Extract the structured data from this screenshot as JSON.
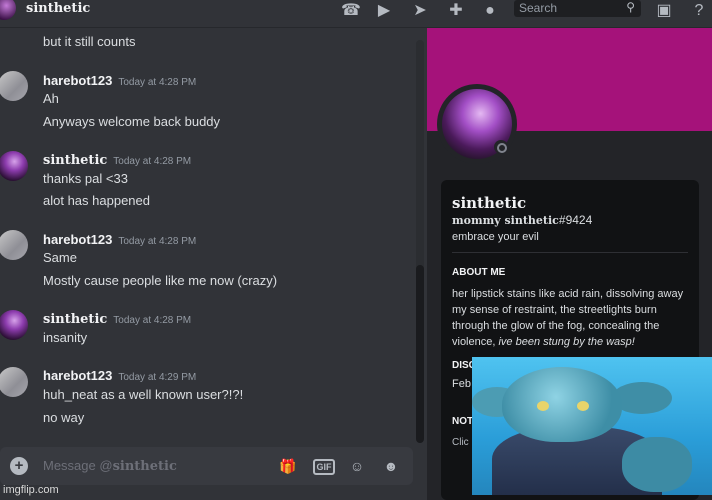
{
  "header": {
    "channel_name": "sinthetic",
    "search_placeholder": "Search",
    "icons": [
      "phone-call-icon",
      "video-icon",
      "pin-icon",
      "add-member-icon",
      "profile-icon",
      "inbox-icon",
      "help-icon"
    ]
  },
  "messages": {
    "m0": {
      "line1": "but it still counts"
    },
    "m1": {
      "user": "harebot123",
      "time": "Today at 4:28 PM",
      "line1": "Ah",
      "line2": "Anyways welcome back buddy"
    },
    "m2": {
      "user": "sinthetic",
      "time": "Today at 4:28 PM",
      "line1": "thanks pal <33",
      "line2": "alot has happened"
    },
    "m3": {
      "user": "harebot123",
      "time": "Today at 4:28 PM",
      "line1": "Same",
      "line2": "Mostly cause people like me now (crazy)"
    },
    "m4": {
      "user": "sinthetic",
      "time": "Today at 4:28 PM",
      "line1": "insanity"
    },
    "m5": {
      "user": "harebot123",
      "time": "Today at 4:29 PM",
      "line1": "huh_neat as a well known user?!?!",
      "line2": "no way"
    }
  },
  "composer": {
    "placeholder_prefix": "Message @",
    "placeholder_name": "sinthetic",
    "gif_label": "GIF"
  },
  "profile": {
    "banner_color": "#a5127a",
    "display_name": "sinthetic",
    "tag_name": "mommy sinthetic",
    "tag_number": "#9424",
    "custom_status": "embrace your evil",
    "about_heading": "ABOUT ME",
    "about_text": "her lipstick stains like acid rain, dissolving away my sense of restraint, the streetlights burn through the glow of the fog, concealing the violence, ",
    "about_italic": "ive been stung by the wasp!",
    "discord_heading": "DISC",
    "discord_value": "Feb",
    "note_heading": "NOT",
    "note_value": "Clic"
  },
  "watermark": "imgflip.com"
}
